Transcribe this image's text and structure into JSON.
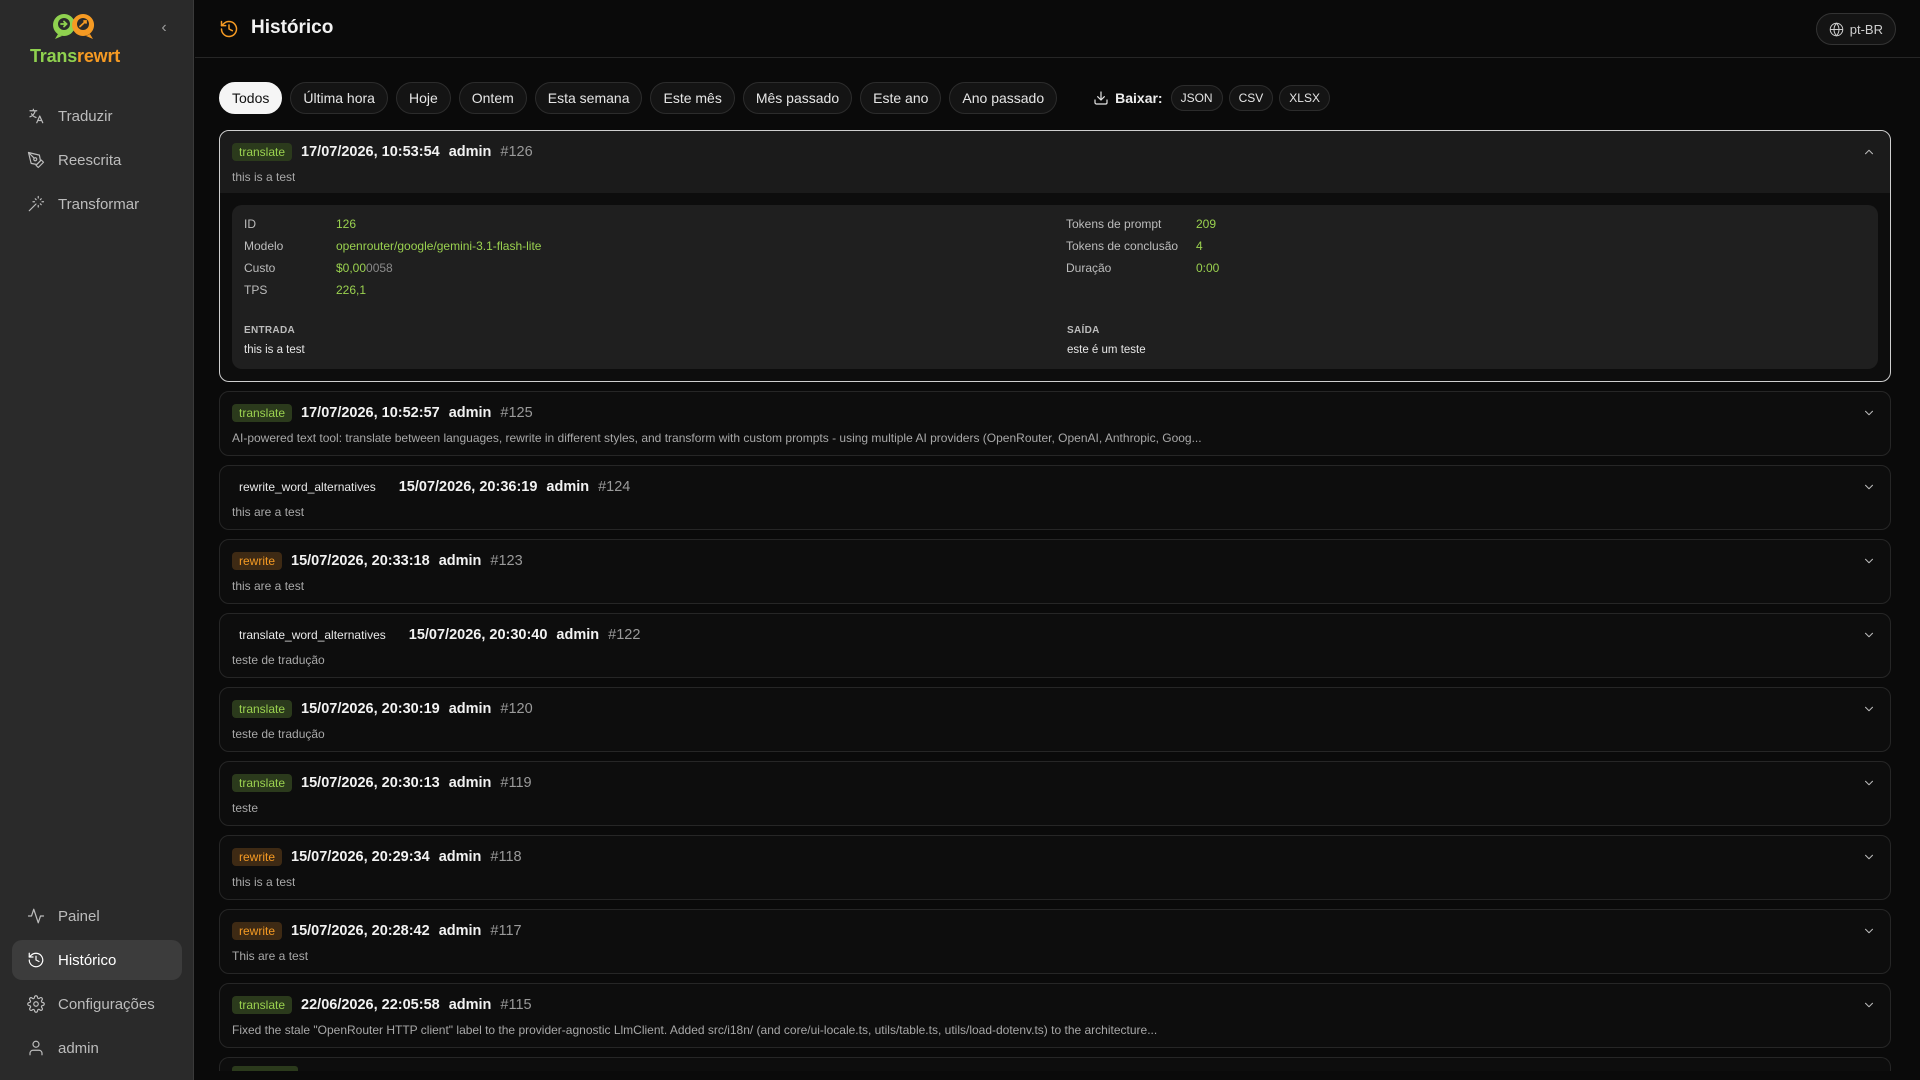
{
  "app": {
    "logo_text_main": "Trans",
    "logo_text_accent": "rewrt"
  },
  "sidebar": {
    "top_items": [
      {
        "label": "Traduzir",
        "icon": "translate-icon"
      },
      {
        "label": "Reescrita",
        "icon": "pen-icon"
      },
      {
        "label": "Transformar",
        "icon": "magic-wand-icon"
      }
    ],
    "bottom_items": [
      {
        "label": "Painel",
        "icon": "activity-icon"
      },
      {
        "label": "Histórico",
        "icon": "history-icon",
        "active": true
      },
      {
        "label": "Configurações",
        "icon": "gear-icon"
      },
      {
        "label": "admin",
        "icon": "user-icon"
      }
    ]
  },
  "header": {
    "title": "Histórico",
    "language": "pt-BR"
  },
  "filters": {
    "chips": [
      "Todos",
      "Última hora",
      "Hoje",
      "Ontem",
      "Esta semana",
      "Este mês",
      "Mês passado",
      "Este ano",
      "Ano passado"
    ],
    "active": "Todos",
    "download_label": "Baixar:",
    "formats": [
      "JSON",
      "CSV",
      "XLSX"
    ]
  },
  "entries": [
    {
      "type": "translate",
      "timestamp": "17/07/2026, 10:53:54",
      "user": "admin",
      "id": "#126",
      "preview": "this is a test",
      "expanded": true
    },
    {
      "type": "translate",
      "timestamp": "17/07/2026, 10:52:57",
      "user": "admin",
      "id": "#125",
      "preview": "AI-powered text tool: translate between languages, rewrite in different styles, and transform with custom prompts - using multiple AI providers (OpenRouter, OpenAI, Anthropic, Goog..."
    },
    {
      "type": "rewrite_word_alternatives",
      "timestamp": "15/07/2026, 20:36:19",
      "user": "admin",
      "id": "#124",
      "preview": "this are a test"
    },
    {
      "type": "rewrite",
      "timestamp": "15/07/2026, 20:33:18",
      "user": "admin",
      "id": "#123",
      "preview": "this are a test"
    },
    {
      "type": "translate_word_alternatives",
      "timestamp": "15/07/2026, 20:30:40",
      "user": "admin",
      "id": "#122",
      "preview": "teste de tradução"
    },
    {
      "type": "translate",
      "timestamp": "15/07/2026, 20:30:19",
      "user": "admin",
      "id": "#120",
      "preview": "teste de tradução"
    },
    {
      "type": "translate",
      "timestamp": "15/07/2026, 20:30:13",
      "user": "admin",
      "id": "#119",
      "preview": "teste"
    },
    {
      "type": "rewrite",
      "timestamp": "15/07/2026, 20:29:34",
      "user": "admin",
      "id": "#118",
      "preview": "this is a test"
    },
    {
      "type": "rewrite",
      "timestamp": "15/07/2026, 20:28:42",
      "user": "admin",
      "id": "#117",
      "preview": "This are a test"
    },
    {
      "type": "translate",
      "timestamp": "22/06/2026, 22:05:58",
      "user": "admin",
      "id": "#115",
      "preview": "Fixed the stale \"OpenRouter HTTP client\" label to the provider-agnostic LlmClient. Added src/i18n/ (and core/ui-locale.ts, utils/table.ts, utils/load-dotenv.ts) to the architecture..."
    }
  ],
  "detail": {
    "id_label": "ID",
    "id_value": "126",
    "model_label": "Modelo",
    "model_value": "openrouter/google/gemini-3.1-flash-lite",
    "cost_label": "Custo",
    "cost_value_main": "$0,00",
    "cost_value_dim": "0058",
    "tps_label": "TPS",
    "tps_value": "226,1",
    "prompt_tokens_label": "Tokens de prompt",
    "prompt_tokens_value": "209",
    "completion_tokens_label": "Tokens de conclusão",
    "completion_tokens_value": "4",
    "duration_label": "Duração",
    "duration_value": "0:00",
    "input_label": "ENTRADA",
    "input_text": "this is a test",
    "output_label": "SAÍDA",
    "output_text": "este é um teste"
  },
  "colors": {
    "translate_badge": "#9ad14f",
    "rewrite_badge": "#f59a23",
    "accent_orange": "#f59a23"
  }
}
